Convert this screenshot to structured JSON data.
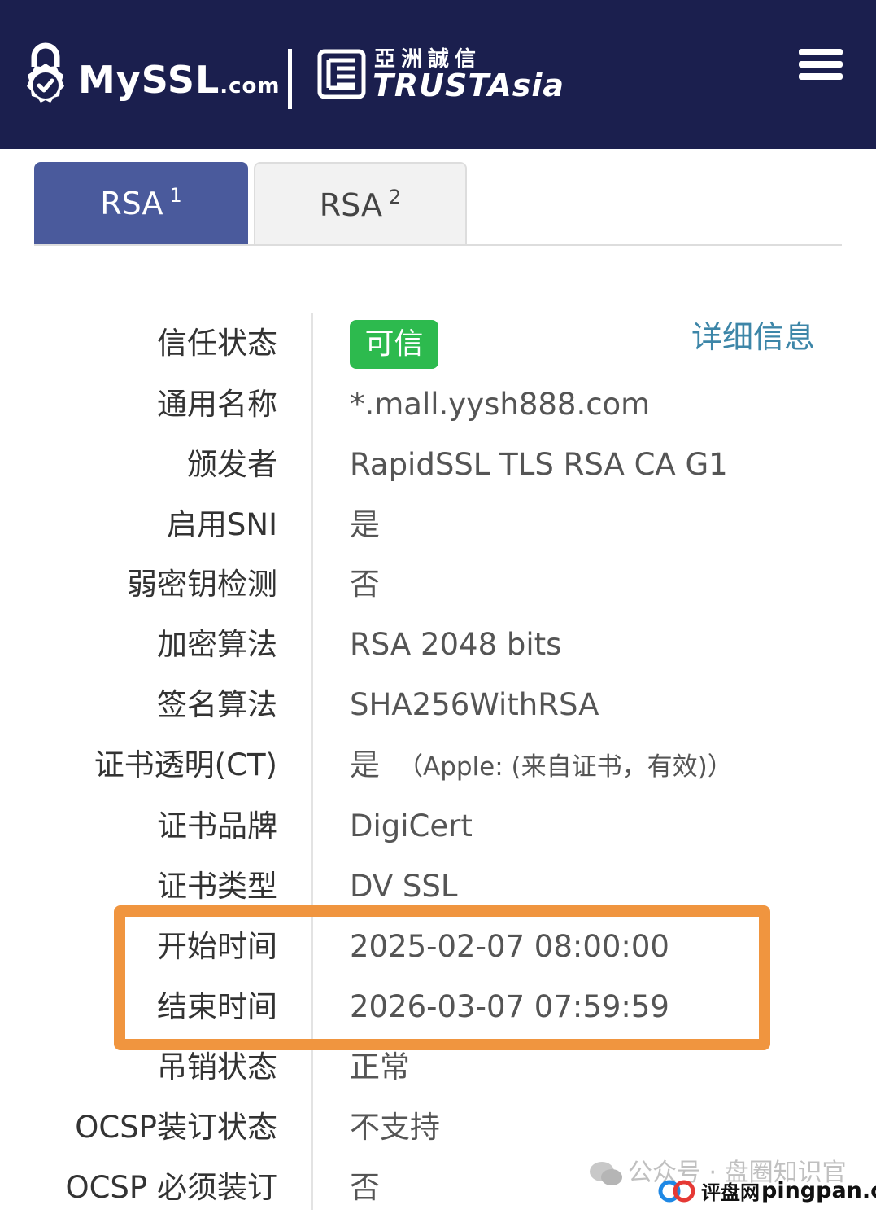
{
  "header": {
    "logo_text": "MySSL",
    "logo_domain": ".com",
    "partner_cn": "亞洲誠信",
    "partner_en": "TRUSTAsia",
    "colors": {
      "background": "#1b1f4e",
      "text": "#ffffff"
    },
    "menu_icon": "hamburger-menu-icon"
  },
  "tabs": [
    {
      "label": "RSA",
      "index": "1",
      "active": true
    },
    {
      "label": "RSA",
      "index": "2",
      "active": false
    }
  ],
  "details_link": "详细信息",
  "trust_badge": {
    "text": "可信",
    "color": "#2dba4e"
  },
  "rows": [
    {
      "label": "信任状态",
      "value": ""
    },
    {
      "label": "通用名称",
      "value": "*.mall.yysh888.com"
    },
    {
      "label": "颁发者",
      "value": "RapidSSL TLS RSA CA G1"
    },
    {
      "label": "启用SNI",
      "value": "是"
    },
    {
      "label": "弱密钥检测",
      "value": "否"
    },
    {
      "label": "加密算法",
      "value": "RSA 2048 bits"
    },
    {
      "label": "签名算法",
      "value": "SHA256WithRSA"
    },
    {
      "label": "证书透明(CT)",
      "value": "是",
      "note": "（Apple: (来自证书，有效)）"
    },
    {
      "label": "证书品牌",
      "value": "DigiCert"
    },
    {
      "label": "证书类型",
      "value": "DV SSL"
    },
    {
      "label": "开始时间",
      "value": "2025-02-07 08:00:00"
    },
    {
      "label": "结束时间",
      "value": "2026-03-07 07:59:59"
    },
    {
      "label": "吊销状态",
      "value": "正常"
    },
    {
      "label": "OCSP装订状态",
      "value": "不支持"
    },
    {
      "label": "OCSP 必须装订",
      "value": "否"
    }
  ],
  "highlight_color": "#f0953f",
  "watermark": {
    "channel": "公众号 · 盘圈知识官",
    "site_cn": "评盘网",
    "site": "pingpan.cc"
  }
}
